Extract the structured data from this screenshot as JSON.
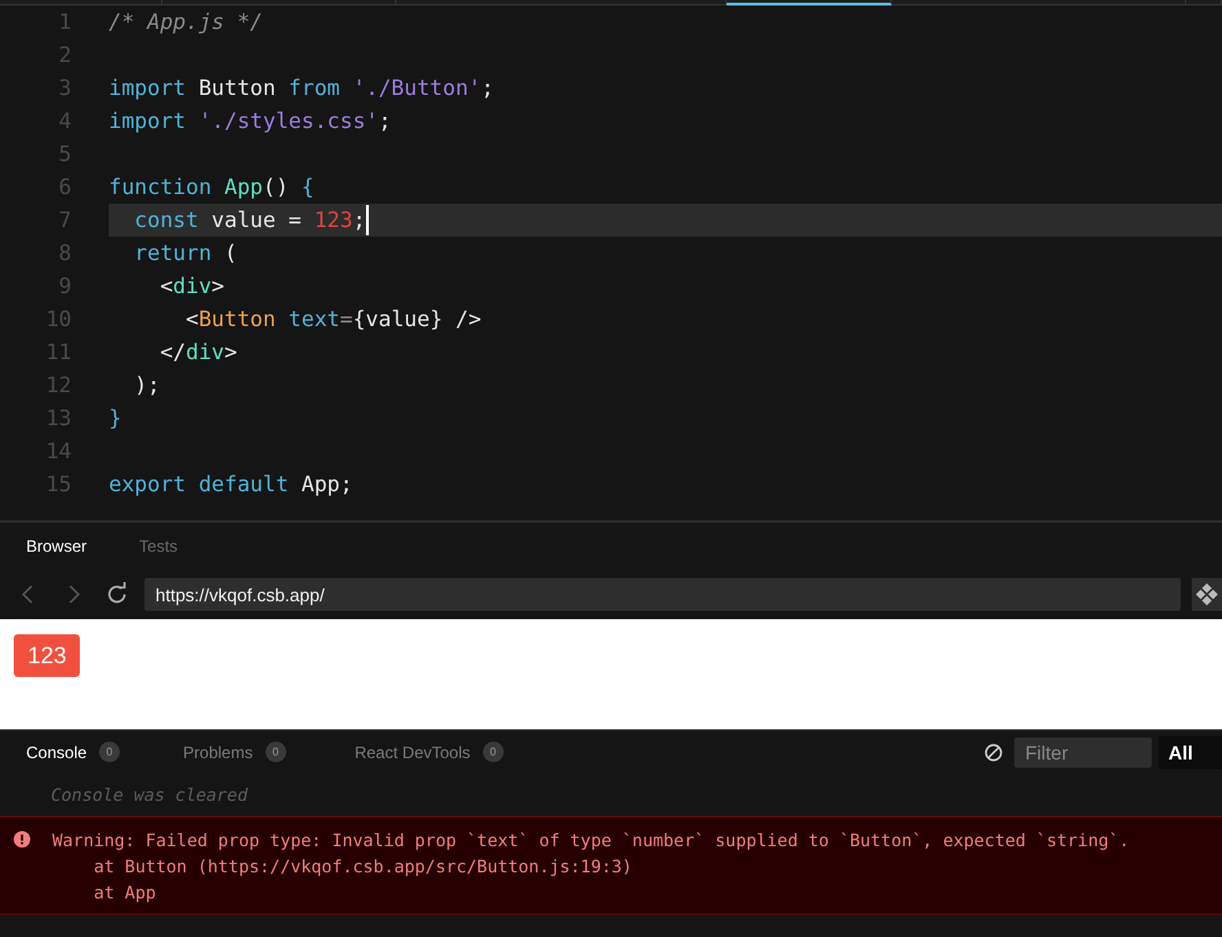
{
  "editor_tabs": [
    {
      "selected": false
    },
    {
      "selected": false
    },
    {
      "selected": false
    },
    {
      "selected": true
    },
    {
      "selected": false
    },
    {
      "selected": false
    }
  ],
  "editor": {
    "lines": [
      {
        "number": "1",
        "current": false,
        "cursor": false,
        "tokens": [
          {
            "kind": "comment",
            "text": "/* App.js */"
          }
        ]
      },
      {
        "number": "2",
        "current": false,
        "cursor": false
      },
      {
        "number": "3",
        "current": false,
        "cursor": false,
        "tokens": [
          {
            "kind": "keyword",
            "text": "import"
          },
          {
            "kind": "plain",
            "text": " Button "
          },
          {
            "kind": "keyword",
            "text": "from"
          },
          {
            "kind": "string",
            "text": " './Button'"
          },
          {
            "kind": "plain",
            "text": ";"
          }
        ]
      },
      {
        "number": "4",
        "current": false,
        "cursor": false,
        "tokens": [
          {
            "kind": "keyword",
            "text": "import"
          },
          {
            "kind": "string",
            "text": " './styles.css'"
          },
          {
            "kind": "plain",
            "text": ";"
          }
        ]
      },
      {
        "number": "5",
        "current": false,
        "cursor": false
      },
      {
        "number": "6",
        "current": false,
        "cursor": false,
        "tokens": [
          {
            "kind": "keyword",
            "text": "function"
          },
          {
            "kind": "function",
            "text": " App"
          },
          {
            "kind": "plain",
            "text": "() "
          },
          {
            "kind": "keyword",
            "text": "{"
          }
        ]
      },
      {
        "number": "7",
        "current": true,
        "cursor": true,
        "tokens": [
          {
            "kind": "keyword",
            "text": "  const"
          },
          {
            "kind": "plain",
            "text": " value = "
          },
          {
            "kind": "number",
            "text": "123"
          },
          {
            "kind": "plain",
            "text": ";"
          }
        ]
      },
      {
        "number": "8",
        "current": false,
        "cursor": false,
        "tokens": [
          {
            "kind": "keyword",
            "text": "  return"
          },
          {
            "kind": "plain",
            "text": " ("
          }
        ]
      },
      {
        "number": "9",
        "current": false,
        "cursor": false,
        "tokens": [
          {
            "kind": "plain",
            "text": "    <"
          },
          {
            "kind": "tag",
            "text": "div"
          },
          {
            "kind": "plain",
            "text": ">"
          }
        ]
      },
      {
        "number": "10",
        "current": false,
        "cursor": false,
        "tokens": [
          {
            "kind": "plain",
            "text": "      <"
          },
          {
            "kind": "component",
            "text": "Button"
          },
          {
            "kind": "attribute",
            "text": " text"
          },
          {
            "kind": "punctuation",
            "text": "="
          },
          {
            "kind": "plain",
            "text": "{value} />"
          }
        ]
      },
      {
        "number": "11",
        "current": false,
        "cursor": false,
        "tokens": [
          {
            "kind": "plain",
            "text": "    </"
          },
          {
            "kind": "tag",
            "text": "div"
          },
          {
            "kind": "plain",
            "text": ">"
          }
        ]
      },
      {
        "number": "12",
        "current": false,
        "cursor": false,
        "tokens": [
          {
            "kind": "plain",
            "text": "  );"
          }
        ]
      },
      {
        "number": "13",
        "current": false,
        "cursor": false,
        "tokens": [
          {
            "kind": "keyword",
            "text": "}"
          }
        ]
      },
      {
        "number": "14",
        "current": false,
        "cursor": false
      },
      {
        "number": "15",
        "current": false,
        "cursor": false,
        "tokens": [
          {
            "kind": "keyword",
            "text": "export default"
          },
          {
            "kind": "plain",
            "text": " App;"
          }
        ]
      }
    ]
  },
  "preview": {
    "tabs": [
      {
        "label": "Browser",
        "selected": true
      },
      {
        "label": "Tests",
        "selected": false
      }
    ],
    "url": "https://vkqof.csb.app/",
    "rendered_button": "123"
  },
  "console": {
    "tabs": [
      {
        "label": "Console",
        "count": "0",
        "selected": true
      },
      {
        "label": "Problems",
        "count": "0",
        "selected": false
      },
      {
        "label": "React DevTools",
        "count": "0",
        "selected": false
      }
    ],
    "filter": {
      "placeholder": "Filter"
    },
    "level": "All",
    "messages": [
      {
        "kind": "info",
        "lines": [
          "Console was cleared"
        ]
      },
      {
        "kind": "error",
        "lines": [
          "Warning: Failed prop type: Invalid prop `text` of type `number` supplied to `Button`, expected `string`.",
          "    at Button (https://vkqof.csb.app/src/Button.js:19:3)",
          "    at App"
        ]
      }
    ]
  }
}
